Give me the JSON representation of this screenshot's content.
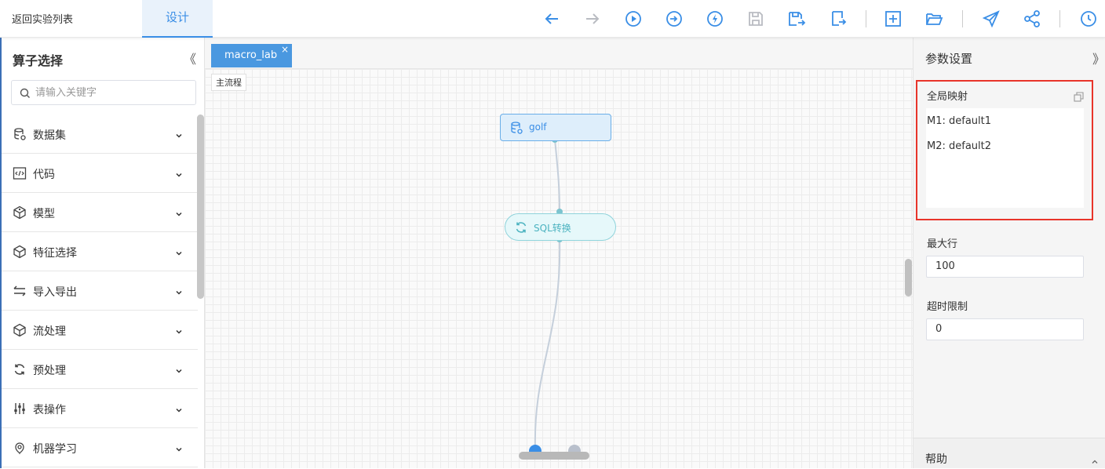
{
  "header": {
    "back_label": "返回实验列表",
    "active_tab": "设计",
    "toolbar_icons": [
      "arrow-left-icon",
      "arrow-right-icon",
      "play-icon",
      "step-run-icon",
      "lightning-icon",
      "save-icon",
      "save-as-icon",
      "export-icon",
      "add-icon",
      "folder-open-icon",
      "send-icon",
      "share-icon",
      "history-icon"
    ]
  },
  "sidebar": {
    "title": "算子选择",
    "collapse_glyph": "《",
    "search_placeholder": "请输入关键字",
    "items": [
      {
        "label": "数据集",
        "icon": "database-icon"
      },
      {
        "label": "代码",
        "icon": "code-icon"
      },
      {
        "label": "模型",
        "icon": "cube-icon"
      },
      {
        "label": "特征选择",
        "icon": "cube-outline-icon"
      },
      {
        "label": "导入导出",
        "icon": "transfer-icon"
      },
      {
        "label": "流处理",
        "icon": "cube-outline-icon"
      },
      {
        "label": "预处理",
        "icon": "refresh-icon"
      },
      {
        "label": "表操作",
        "icon": "sliders-icon"
      },
      {
        "label": "机器学习",
        "icon": "brain-icon"
      }
    ]
  },
  "canvas": {
    "tab_label": "macro_lab",
    "tab_close": "×",
    "flow_label": "主流程",
    "nodes": [
      {
        "label": "golf",
        "icon": "database-icon"
      },
      {
        "label": "SQL转换",
        "icon": "refresh-icon"
      }
    ]
  },
  "right_panel": {
    "title": "参数设置",
    "collapse_glyph": "》",
    "global_mapping": {
      "label": "全局映射",
      "lines": [
        "M1: default1",
        "M2: default2"
      ]
    },
    "max_rows": {
      "label": "最大行",
      "value": "100"
    },
    "timeout": {
      "label": "超时限制",
      "value": "0"
    },
    "help_label": "帮助"
  },
  "colors": {
    "accent": "#3a8ee6",
    "highlight": "#e8342a",
    "node_teal": "#4cb3c0"
  }
}
